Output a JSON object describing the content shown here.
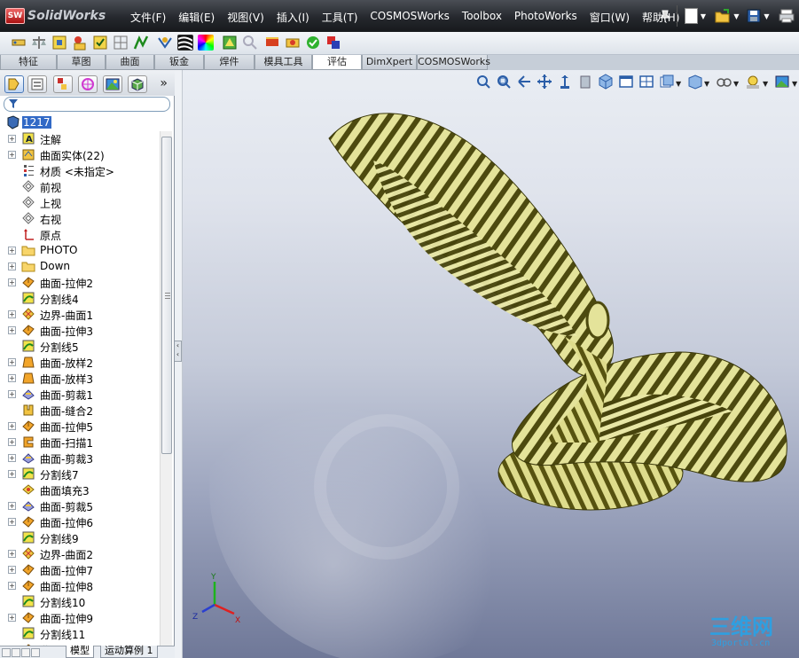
{
  "app": {
    "logo_text": "SolidWorks"
  },
  "menu": [
    "文件(F)",
    "编辑(E)",
    "视图(V)",
    "插入(I)",
    "工具(T)",
    "COSMOSWorks",
    "Toolbox",
    "PhotoWorks",
    "窗口(W)",
    "帮助(H)"
  ],
  "command_tabs": [
    {
      "label": "特征",
      "active": false
    },
    {
      "label": "草图",
      "active": false
    },
    {
      "label": "曲面",
      "active": false
    },
    {
      "label": "钣金",
      "active": false
    },
    {
      "label": "焊件",
      "active": false
    },
    {
      "label": "模具工具",
      "active": false
    },
    {
      "label": "评估",
      "active": true
    },
    {
      "label": "DimXpert",
      "active": false
    },
    {
      "label": "COSMOSWorks",
      "active": false
    }
  ],
  "tree": {
    "root": "1217",
    "items": [
      {
        "label": "注解",
        "icon": "annotation-icon",
        "expandable": true
      },
      {
        "label": "曲面实体(22)",
        "icon": "surface-bodies-icon",
        "expandable": true
      },
      {
        "label": "材质 <未指定>",
        "icon": "material-icon",
        "expandable": false
      },
      {
        "label": "前视",
        "icon": "plane-icon",
        "expandable": false
      },
      {
        "label": "上视",
        "icon": "plane-icon",
        "expandable": false
      },
      {
        "label": "右视",
        "icon": "plane-icon",
        "expandable": false
      },
      {
        "label": "原点",
        "icon": "origin-icon",
        "expandable": false
      },
      {
        "label": "PHOTO",
        "icon": "folder-icon",
        "expandable": true
      },
      {
        "label": "Down",
        "icon": "folder-icon",
        "expandable": true
      },
      {
        "label": "曲面-拉伸2",
        "icon": "surface-extrude-icon",
        "expandable": true
      },
      {
        "label": "分割线4",
        "icon": "split-line-icon",
        "expandable": false
      },
      {
        "label": "边界-曲面1",
        "icon": "boundary-surface-icon",
        "expandable": true
      },
      {
        "label": "曲面-拉伸3",
        "icon": "surface-extrude-icon",
        "expandable": true
      },
      {
        "label": "分割线5",
        "icon": "split-line-icon",
        "expandable": false
      },
      {
        "label": "曲面-放样2",
        "icon": "surface-loft-icon",
        "expandable": true
      },
      {
        "label": "曲面-放样3",
        "icon": "surface-loft-icon",
        "expandable": true
      },
      {
        "label": "曲面-剪裁1",
        "icon": "surface-trim-icon",
        "expandable": true
      },
      {
        "label": "曲面-缝合2",
        "icon": "surface-knit-icon",
        "expandable": false
      },
      {
        "label": "曲面-拉伸5",
        "icon": "surface-extrude-icon",
        "expandable": true
      },
      {
        "label": "曲面-扫描1",
        "icon": "surface-sweep-icon",
        "expandable": true
      },
      {
        "label": "曲面-剪裁3",
        "icon": "surface-trim-icon",
        "expandable": true
      },
      {
        "label": "分割线7",
        "icon": "split-line-icon",
        "expandable": true
      },
      {
        "label": "曲面填充3",
        "icon": "surface-fill-icon",
        "expandable": false
      },
      {
        "label": "曲面-剪裁5",
        "icon": "surface-trim-icon",
        "expandable": true
      },
      {
        "label": "曲面-拉伸6",
        "icon": "surface-extrude-icon",
        "expandable": true
      },
      {
        "label": "分割线9",
        "icon": "split-line-icon",
        "expandable": false
      },
      {
        "label": "边界-曲面2",
        "icon": "boundary-surface-icon",
        "expandable": true
      },
      {
        "label": "曲面-拉伸7",
        "icon": "surface-extrude-icon",
        "expandable": true
      },
      {
        "label": "曲面-拉伸8",
        "icon": "surface-extrude-icon",
        "expandable": true
      },
      {
        "label": "分割线10",
        "icon": "split-line-icon",
        "expandable": false
      },
      {
        "label": "曲面-拉伸9",
        "icon": "surface-extrude-icon",
        "expandable": true
      },
      {
        "label": "分割线11",
        "icon": "split-line-icon",
        "expandable": false
      },
      {
        "label": "曲面-...",
        "icon": "surface-extrude-icon",
        "expandable": true
      }
    ]
  },
  "bottom_tabs": [
    "模型",
    "运动算例 1"
  ],
  "triad": {
    "x": "X",
    "y": "Y",
    "z": "Z"
  },
  "watermark": {
    "title": "三维网",
    "url": "3dportal.cn"
  },
  "colors": {
    "menubar": "#25282d",
    "selection": "#3169c6",
    "zebra_light": "#e4e39a",
    "zebra_dark": "#4d4a0f",
    "watermark": "#2f9fe0"
  }
}
